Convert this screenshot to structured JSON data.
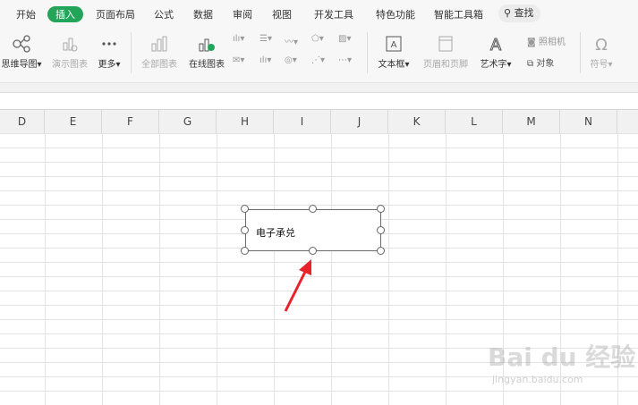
{
  "menu": {
    "tabs": [
      "开始",
      "插入",
      "页面布局",
      "公式",
      "数据",
      "审阅",
      "视图",
      "开发工具",
      "特色功能",
      "智能工具箱"
    ],
    "active_tab": "插入",
    "search_label": "查找"
  },
  "ribbon": {
    "mindmap": "思维导图",
    "demo_chart": "演示图表",
    "more": "更多",
    "all_charts": "全部图表",
    "online_chart": "在线图表",
    "textbox": "文本框",
    "header_footer": "页眉和页脚",
    "wordart": "艺术字",
    "camera": "照相机",
    "object": "对象",
    "symbol": "符号"
  },
  "columns": [
    "D",
    "E",
    "F",
    "G",
    "H",
    "I",
    "J",
    "K",
    "L",
    "M",
    "N"
  ],
  "textbox": {
    "text": "电子承兑"
  },
  "colors": {
    "active_tab": "#22a559",
    "arrow": "#e8232a"
  },
  "watermark": {
    "brand": "Bai du 经验",
    "url": "jingyan.baidu.com"
  }
}
